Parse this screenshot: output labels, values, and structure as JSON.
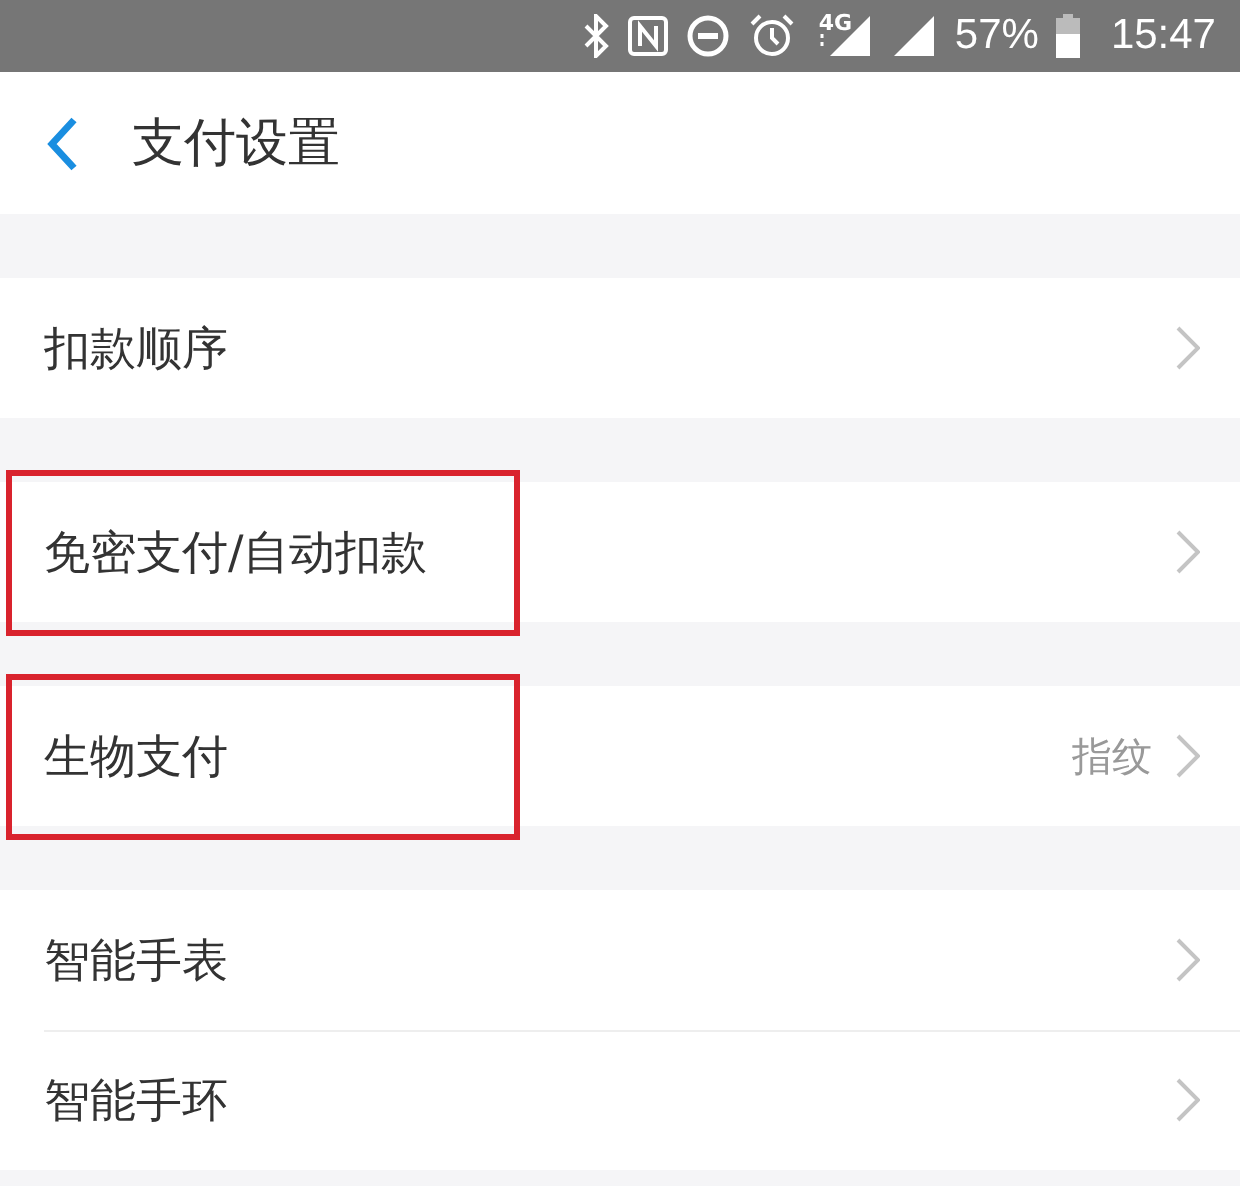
{
  "status_bar": {
    "network": "4G",
    "battery": "57%",
    "time": "15:47"
  },
  "header": {
    "title": "支付设置"
  },
  "groups": [
    {
      "items": [
        {
          "label": "扣款顺序",
          "highlighted": false
        }
      ]
    },
    {
      "items": [
        {
          "label": "免密支付/自动扣款",
          "highlighted": true
        }
      ]
    },
    {
      "items": [
        {
          "label": "生物支付",
          "value": "指纹",
          "highlighted": true
        }
      ]
    },
    {
      "items": [
        {
          "label": "智能手表",
          "highlighted": false
        },
        {
          "label": "智能手环",
          "highlighted": false
        }
      ]
    }
  ]
}
